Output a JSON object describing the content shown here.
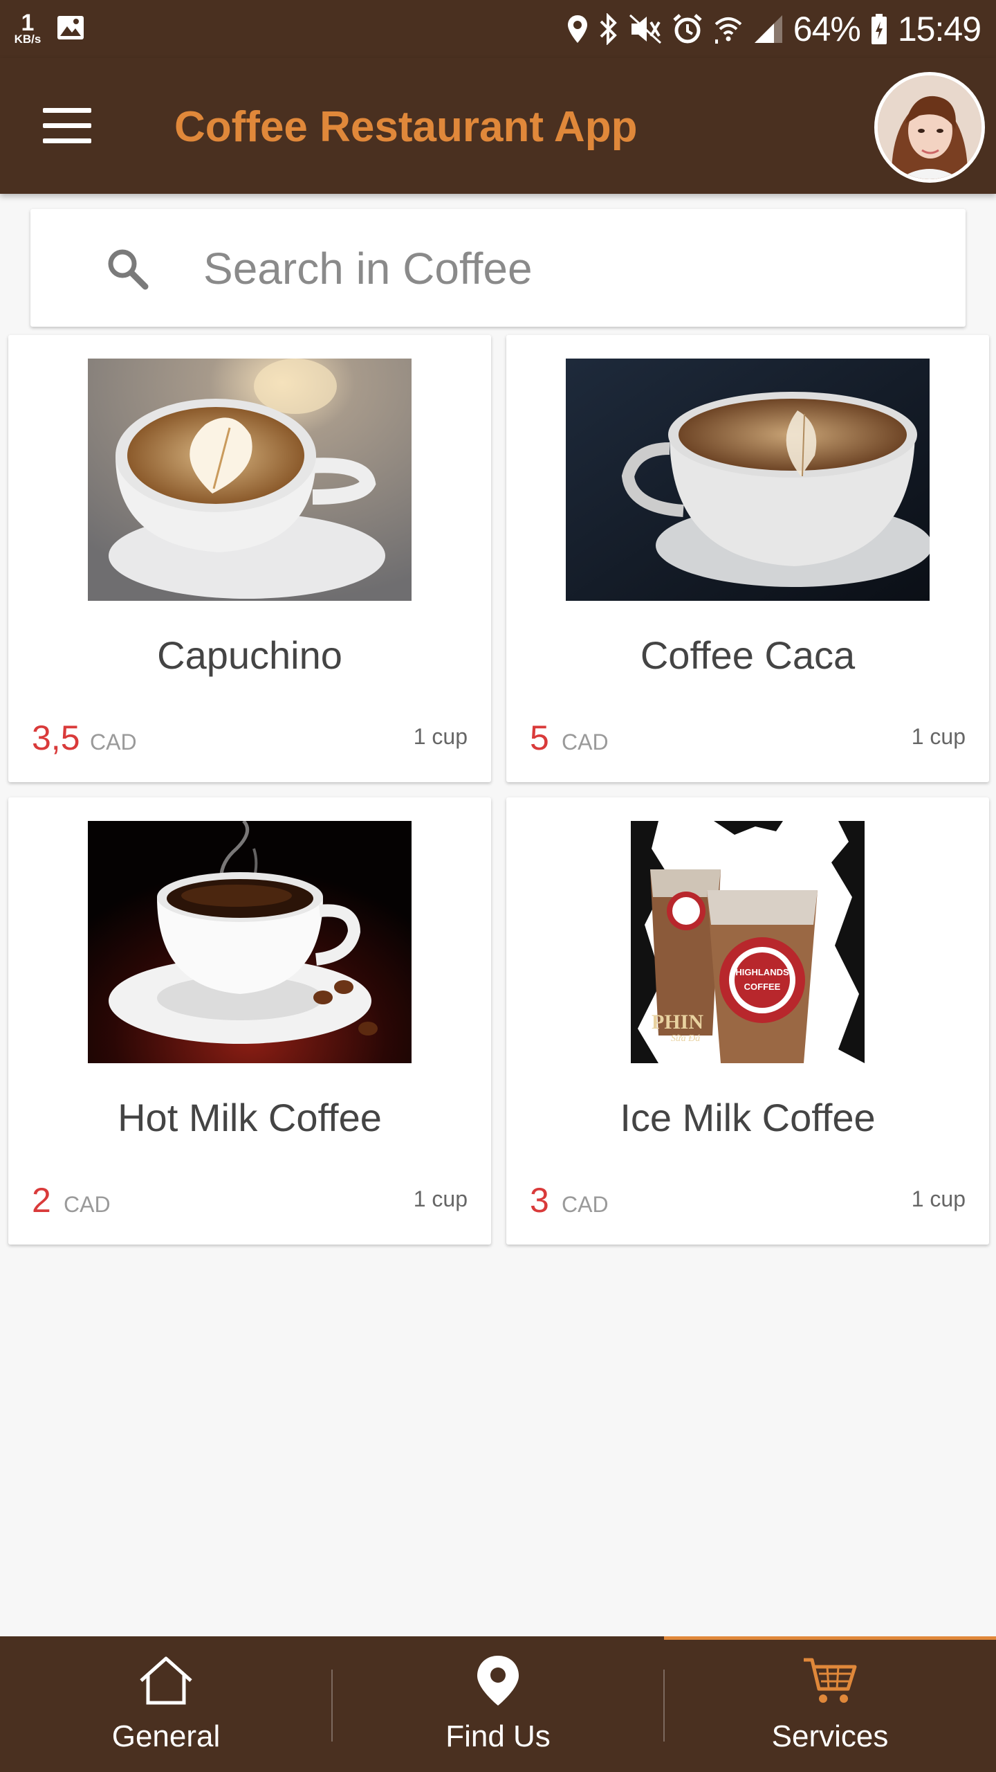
{
  "status_bar": {
    "speed_value": "1",
    "speed_unit": "KB/s",
    "battery": "64%",
    "time": "15:49",
    "icons": [
      "gallery-icon",
      "location-icon",
      "bluetooth-icon",
      "mute-icon",
      "alarm-icon",
      "wifi-icon",
      "signal-icon",
      "battery-icon"
    ]
  },
  "app_bar": {
    "title": "Coffee Restaurant App",
    "title_color": "#e0883a",
    "background": "#4a3020"
  },
  "search": {
    "placeholder": "Search in Coffee",
    "value": ""
  },
  "products": [
    {
      "name": "Capuchino",
      "price": "3,5",
      "currency": "CAD",
      "quantity": "1 cup"
    },
    {
      "name": "Coffee Caca",
      "price": "5",
      "currency": "CAD",
      "quantity": "1 cup"
    },
    {
      "name": "Hot Milk Coffee",
      "price": "2",
      "currency": "CAD",
      "quantity": "1 cup"
    },
    {
      "name": "Ice Milk Coffee",
      "price": "3",
      "currency": "CAD",
      "quantity": "1 cup"
    }
  ],
  "product_image_text": {
    "logo_top": "HIGHLANDS",
    "logo_bottom": "COFFEE",
    "phin": "PHIN",
    "phin_sub": "Sữa Đá"
  },
  "bottom_nav": {
    "items": [
      {
        "label": "General",
        "icon": "home-icon",
        "active": false
      },
      {
        "label": "Find Us",
        "icon": "map-pin-icon",
        "active": false
      },
      {
        "label": "Services",
        "icon": "shopping-cart-icon",
        "active": true
      }
    ],
    "accent": "#e0883a"
  }
}
